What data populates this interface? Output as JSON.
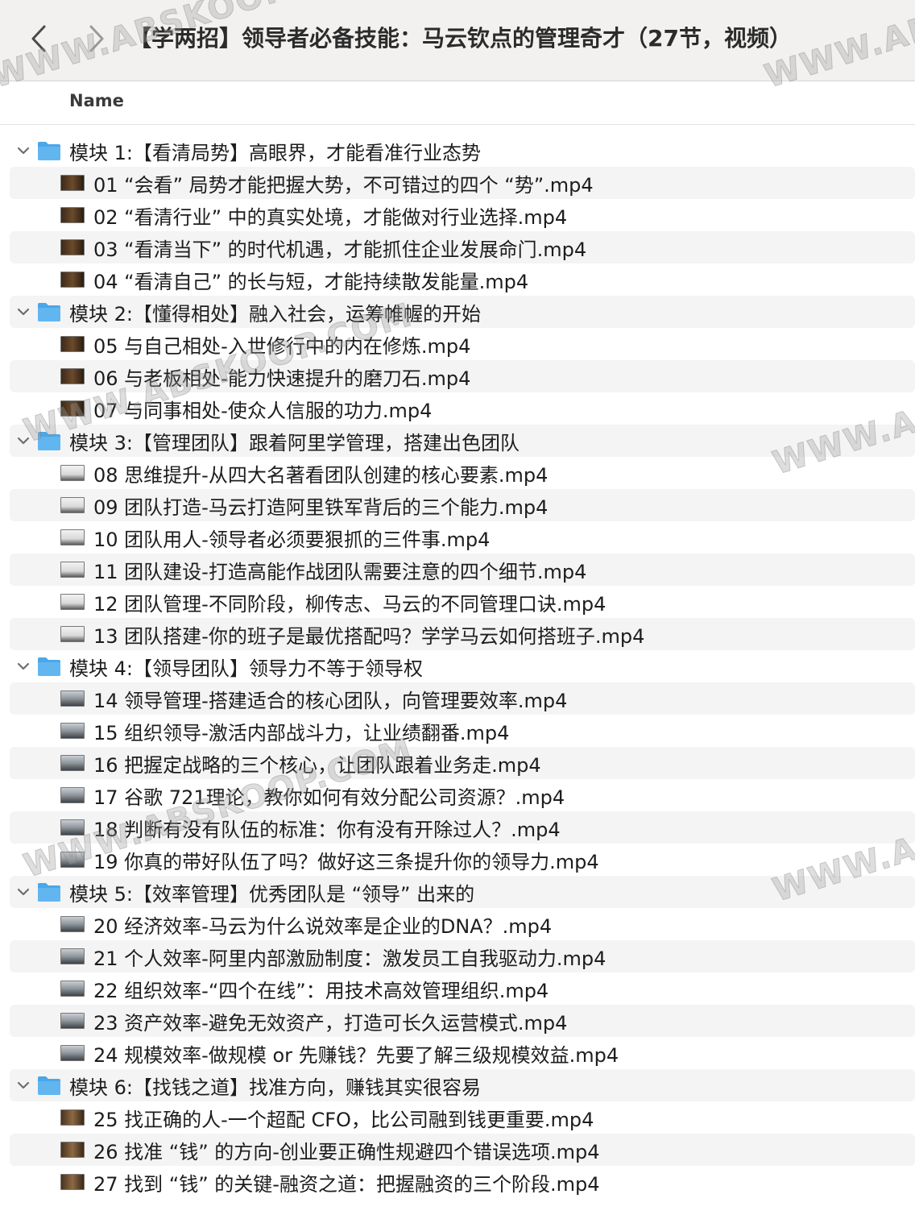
{
  "window": {
    "title": "【学两招】领导者必备技能：马云钦点的管理奇才（27节，视频）",
    "back_icon": "chevron-left-icon",
    "forward_icon": "chevron-right-icon"
  },
  "columns": {
    "name": "Name"
  },
  "watermark": "WWW.ABSKOOP.COM",
  "colors": {
    "folder": "#4aa7e8",
    "alt_row": "#f4f4f4",
    "toolbar": "#f3f1ef"
  },
  "groups": [
    {
      "label": "模块 1:【看清局势】高眼界，才能看准行业态势",
      "thumb": "dark",
      "files": [
        "01 “会看” 局势才能把握大势，不可错过的四个 “势”.mp4",
        "02 “看清行业” 中的真实处境，才能做对行业选择.mp4",
        "03 “看清当下” 的时代机遇，才能抓住企业发展命门.mp4",
        "04 “看清自己” 的长与短，才能持续散发能量.mp4"
      ]
    },
    {
      "label": "模块 2:【懂得相处】融入社会，运筹帷幄的开始",
      "thumb": "dark",
      "files": [
        "05 与自己相处-入世修行中的内在修炼.mp4",
        "06 与老板相处-能力快速提升的磨刀石.mp4",
        "07 与同事相处-使众人信服的功力.mp4"
      ]
    },
    {
      "label": "模块 3:【管理团队】跟着阿里学管理，搭建出色团队",
      "thumb": "light",
      "files": [
        "08 思维提升-从四大名著看团队创建的核心要素.mp4",
        "09 团队打造-马云打造阿里铁军背后的三个能力.mp4",
        "10 团队用人-领导者必须要狠抓的三件事.mp4",
        "11 团队建设-打造高能作战团队需要注意的四个细节.mp4",
        "12 团队管理-不同阶段，柳传志、马云的不同管理口诀.mp4",
        "13 团队搭建-你的班子是最优搭配吗？学学马云如何搭班子.mp4"
      ]
    },
    {
      "label": "模块 4:【领导团队】领导力不等于领导权",
      "thumb": "gray",
      "files": [
        "14 领导管理-搭建适合的核心团队，向管理要效率.mp4",
        "15 组织领导-激活内部战斗力，让业绩翻番.mp4",
        "16 把握定战略的三个核心，让团队跟着业务走.mp4",
        "17 谷歌 721理论，教你如何有效分配公司资源？.mp4",
        "18 判断有没有队伍的标准：你有没有开除过人？.mp4",
        "19 你真的带好队伍了吗？做好这三条提升你的领导力.mp4"
      ]
    },
    {
      "label": "模块 5:【效率管理】优秀团队是 “领导” 出来的",
      "thumb": "gray",
      "files": [
        "20 经济效率-马云为什么说效率是企业的DNA？.mp4",
        "21 个人效率-阿里内部激励制度：激发员工自我驱动力.mp4",
        "22 组织效率-“四个在线”：用技术高效管理组织.mp4",
        "23 资产效率-避免无效资产，打造可长久运营模式.mp4",
        "24 规模效率-做规模 or 先赚钱？先要了解三级规模效益.mp4"
      ]
    },
    {
      "label": "模块 6:【找钱之道】找准方向，赚钱其实很容易",
      "thumb": "brown",
      "files": [
        "25 找正确的人-一个超配 CFO，比公司融到钱更重要.mp4",
        "26 找准 “钱” 的方向-创业要正确性规避四个错误选项.mp4",
        "27 找到 “钱” 的关键-融资之道：把握融资的三个阶段.mp4"
      ]
    }
  ]
}
